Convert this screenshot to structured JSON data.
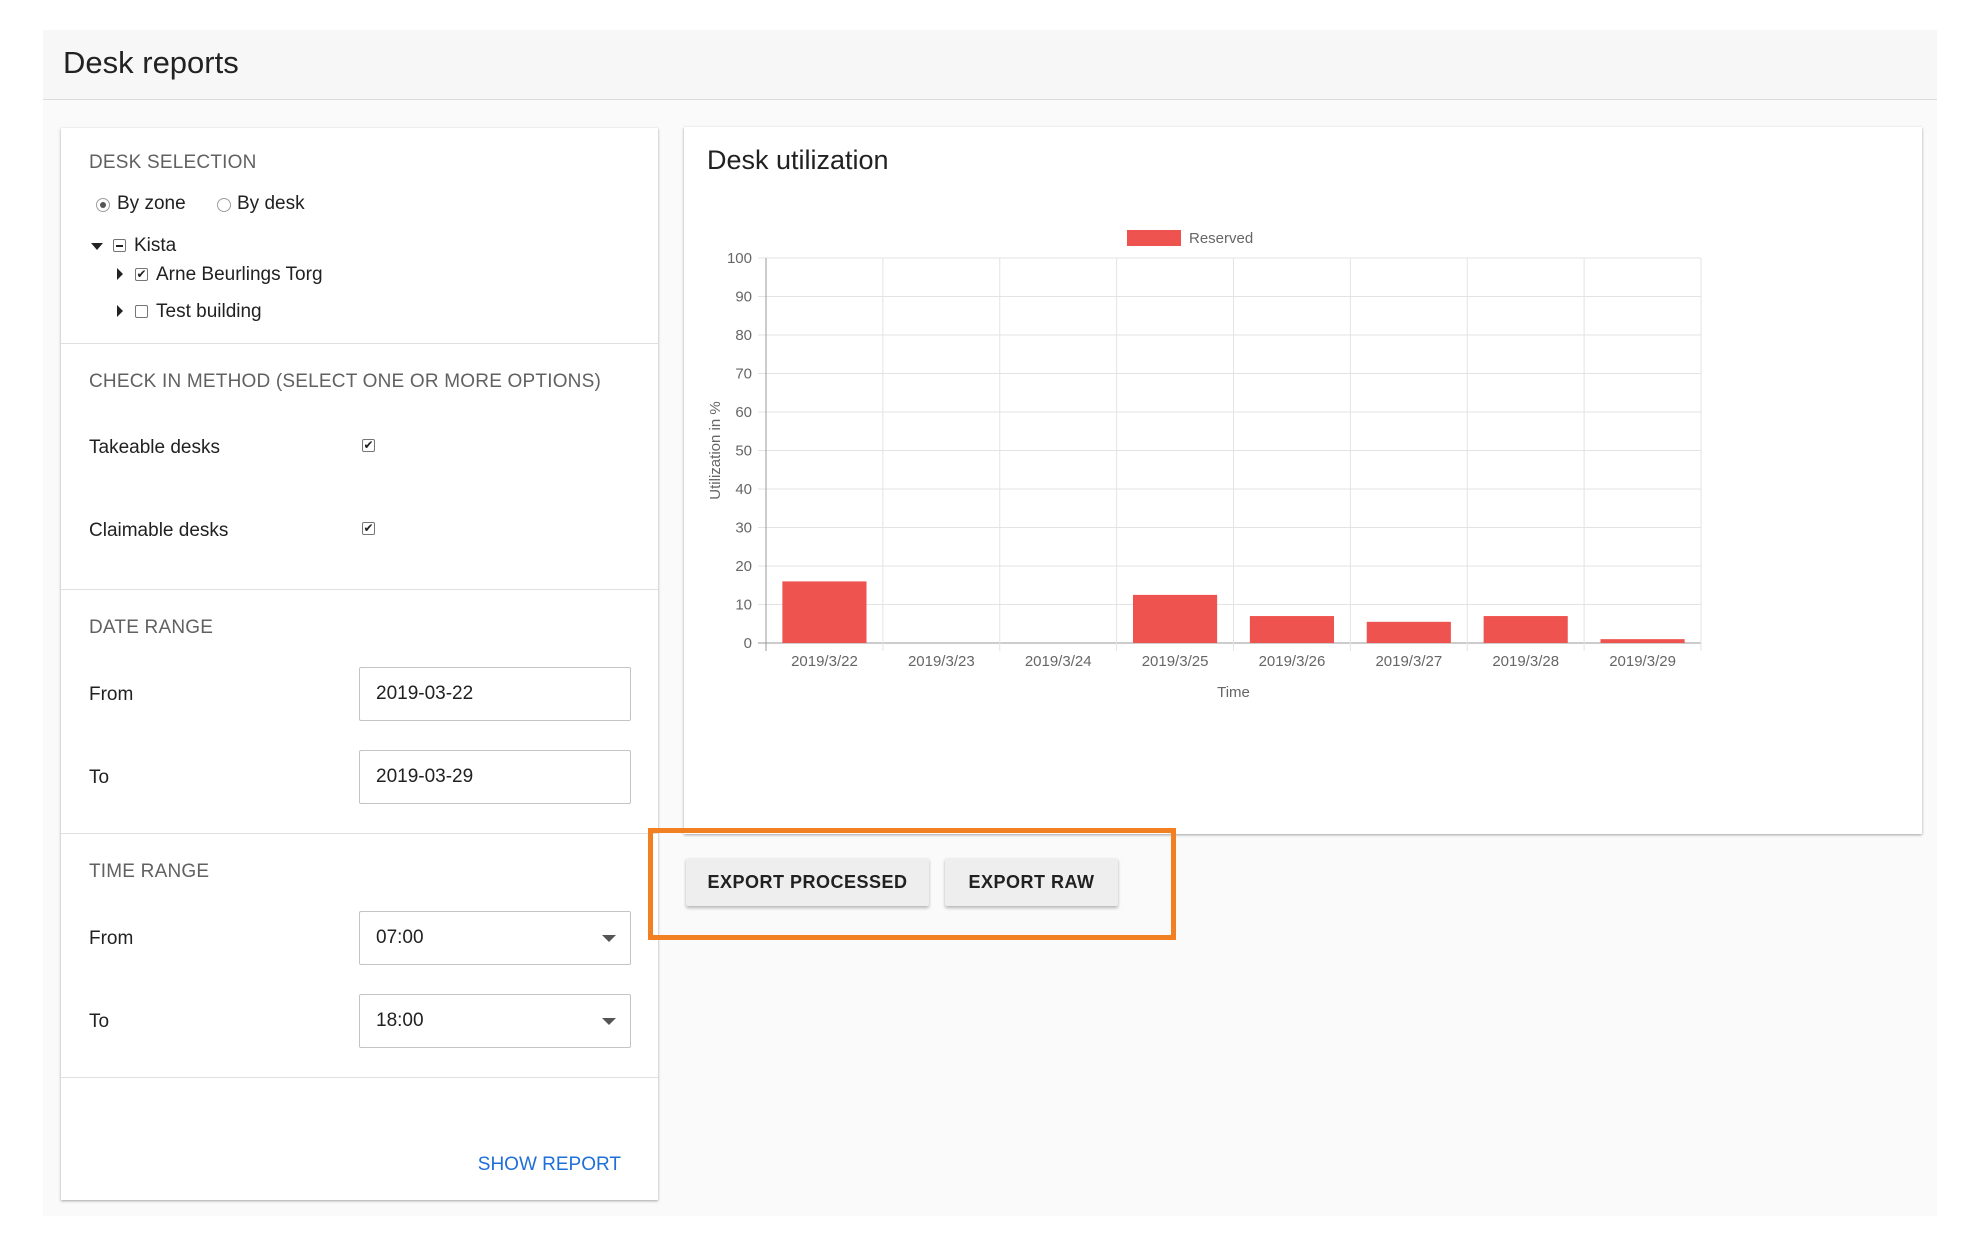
{
  "header": {
    "title": "Desk reports"
  },
  "desk_selection": {
    "title": "DESK SELECTION",
    "mode_options": [
      {
        "label": "By zone",
        "selected": true
      },
      {
        "label": "By desk",
        "selected": false
      }
    ],
    "tree": {
      "root": {
        "label": "Kista",
        "state": "indeterminate",
        "expanded": true
      },
      "children": [
        {
          "label": "Arne Beurlings Torg",
          "checked": true
        },
        {
          "label": "Test building",
          "checked": false
        }
      ]
    }
  },
  "check_in": {
    "title": "CHECK IN METHOD (SELECT ONE OR MORE OPTIONS)",
    "options": [
      {
        "label": "Takeable desks",
        "checked": true
      },
      {
        "label": "Claimable desks",
        "checked": true
      }
    ]
  },
  "date_range": {
    "title": "DATE RANGE",
    "from_label": "From",
    "from_value": "2019-03-22",
    "to_label": "To",
    "to_value": "2019-03-29"
  },
  "time_range": {
    "title": "TIME RANGE",
    "from_label": "From",
    "from_value": "07:00",
    "to_label": "To",
    "to_value": "18:00"
  },
  "show_report_label": "SHOW REPORT",
  "chart_card": {
    "title": "Desk utilization"
  },
  "export": {
    "processed_label": "EXPORT PROCESSED",
    "raw_label": "EXPORT RAW"
  },
  "colors": {
    "accent": "#1e6fd9",
    "bar": "#ef5350",
    "highlight": "#f28022"
  },
  "chart_data": {
    "type": "bar",
    "categories": [
      "2019/3/22",
      "2019/3/23",
      "2019/3/24",
      "2019/3/25",
      "2019/3/26",
      "2019/3/27",
      "2019/3/28",
      "2019/3/29"
    ],
    "series": [
      {
        "name": "Reserved",
        "values": [
          16,
          0,
          0,
          12.5,
          7,
          5.5,
          7,
          1
        ],
        "color": "#ef5350"
      }
    ],
    "xlabel": "Time",
    "ylabel": "Utilization in %",
    "ylim": [
      0,
      100
    ],
    "yticks": [
      0,
      10,
      20,
      30,
      40,
      50,
      60,
      70,
      80,
      90,
      100
    ],
    "grid": true,
    "legend": "top-center"
  }
}
